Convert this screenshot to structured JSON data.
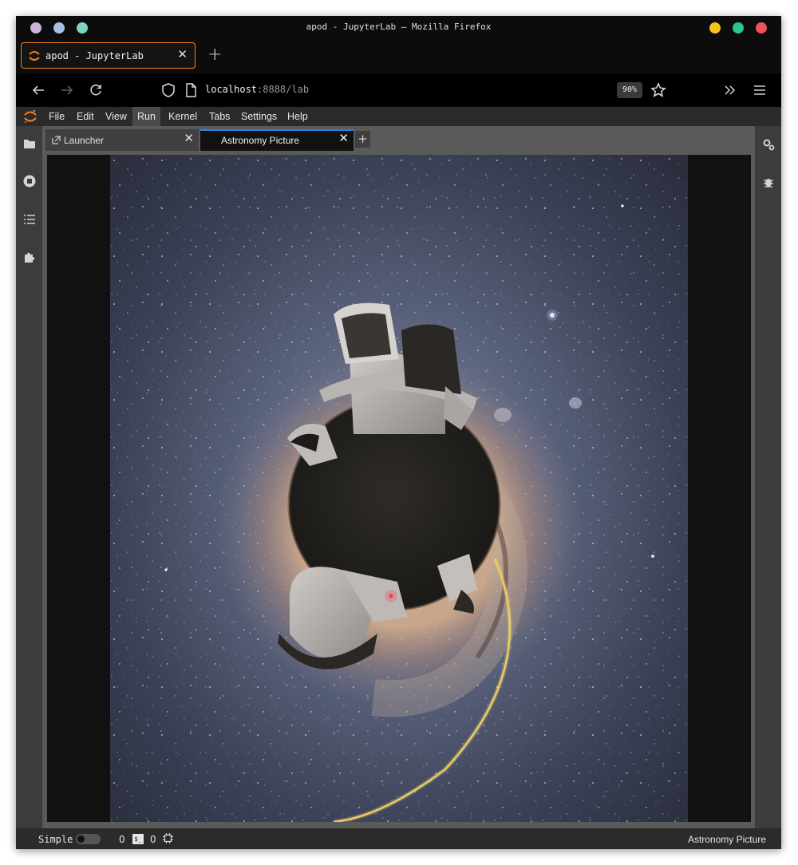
{
  "window": {
    "title": "apod - JupyterLab — Mozilla Firefox",
    "left_dots": [
      "#c9b3d9",
      "#a7bde6",
      "#7fd4c2"
    ],
    "right_dots": [
      "#f5c21b",
      "#2bc48a",
      "#f0525b"
    ]
  },
  "browser": {
    "tab_title": "apod - JupyterLab",
    "url_host": "localhost",
    "url_rest": ":8888/lab",
    "zoom": "90%",
    "accent": "#f58220"
  },
  "jupyter": {
    "menu": [
      "File",
      "Edit",
      "View",
      "Run",
      "Kernel",
      "Tabs",
      "Settings",
      "Help"
    ],
    "active_menu": "Run",
    "tabs": [
      {
        "label": "Launcher",
        "icon": "launcher-icon"
      },
      {
        "label": "Astronomy Picture",
        "icon": "none"
      }
    ],
    "active_tab": "Astronomy Picture",
    "status": {
      "mode": "Simple",
      "terminals": "0",
      "kernels": "0",
      "right": "Astronomy Picture"
    }
  }
}
